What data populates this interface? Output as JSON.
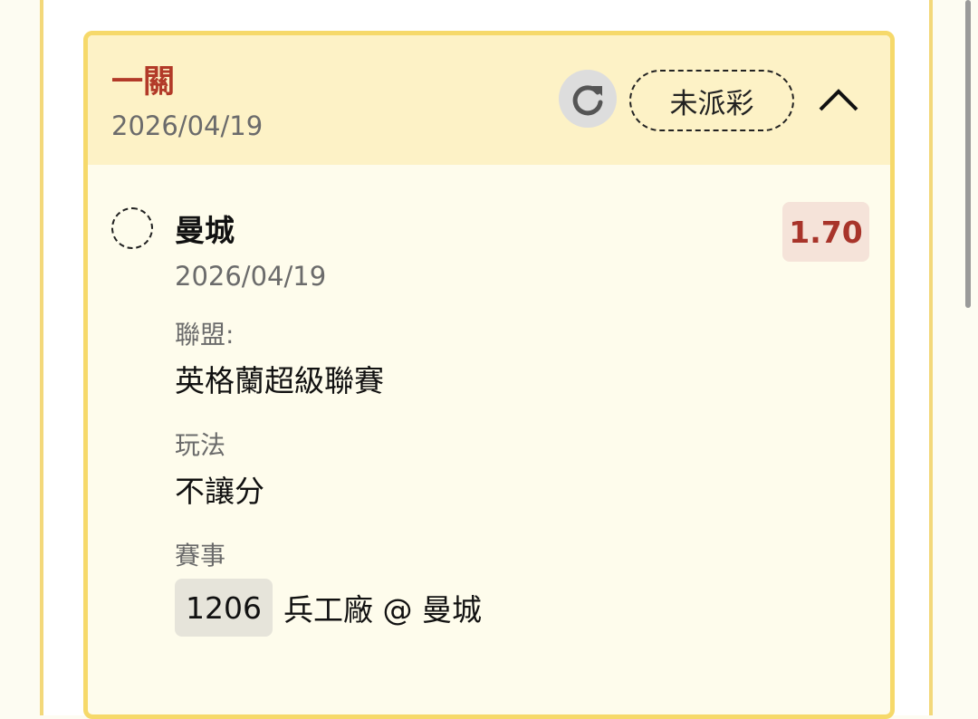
{
  "bet": {
    "type_label": "一關",
    "date": "2026/04/19",
    "status": "未派彩"
  },
  "icons": {
    "refresh": "refresh-icon",
    "collapse": "chevron-up-icon",
    "selection": "dashed-circle-icon"
  },
  "selection": {
    "team": "曼城",
    "date": "2026/04/19",
    "odds": "1.70",
    "league_label": "聯盟:",
    "league": "英格蘭超級聯賽",
    "market_label": "玩法",
    "market": "不讓分",
    "event_label": "賽事",
    "match_id": "1206",
    "match": "兵工廠 @ 曼城"
  },
  "colors": {
    "accent_red": "#b23a28",
    "card_border": "#f6d96a",
    "header_bg": "#fdf2c6",
    "odds_bg": "#f5e3d9"
  }
}
